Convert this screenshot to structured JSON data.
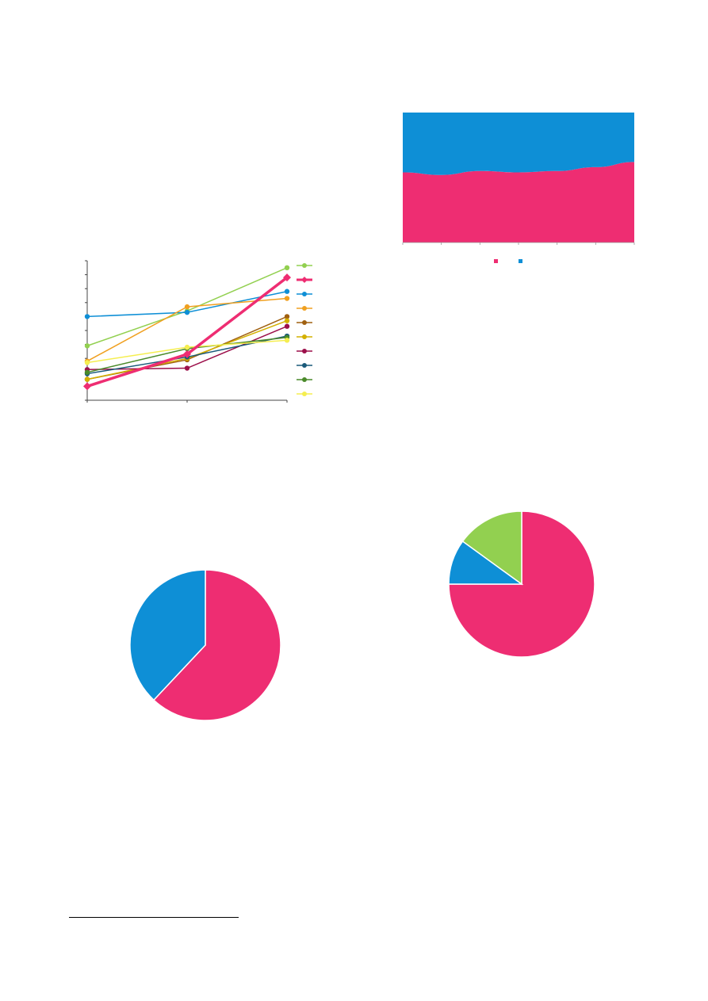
{
  "chart_data": [
    {
      "type": "line",
      "x": [
        0,
        1,
        2
      ],
      "ylim": [
        0,
        100
      ],
      "series": [
        {
          "color": "#92d050",
          "values": [
            39,
            64,
            95
          ],
          "marker": "circle"
        },
        {
          "color": "#ee2d72",
          "values": [
            10,
            33,
            88
          ],
          "marker": "diamond",
          "bold": true
        },
        {
          "color": "#0e8fd6",
          "values": [
            60,
            63,
            78
          ],
          "marker": "circle"
        },
        {
          "color": "#f0a020",
          "values": [
            28,
            67,
            73
          ],
          "marker": "circle"
        },
        {
          "color": "#a06010",
          "values": [
            15,
            29,
            60
          ],
          "marker": "circle"
        },
        {
          "color": "#d4b000",
          "values": [
            15,
            30,
            57
          ],
          "marker": "circle"
        },
        {
          "color": "#9c0f4a",
          "values": [
            22,
            23,
            53
          ],
          "marker": "circle"
        },
        {
          "color": "#1a5a7a",
          "values": [
            19,
            31,
            46
          ],
          "marker": "circle"
        },
        {
          "color": "#4a8a2a",
          "values": [
            20,
            37,
            45
          ],
          "marker": "circle"
        },
        {
          "color": "#f5ee50",
          "values": [
            27,
            38,
            43
          ],
          "marker": "circle"
        }
      ]
    },
    {
      "type": "area",
      "stacked_percent": true,
      "x": [
        0,
        1,
        2,
        3,
        4,
        5,
        6
      ],
      "ylim": [
        0,
        100
      ],
      "series": [
        {
          "color": "#ee2d72",
          "values": [
            54,
            52,
            55,
            54,
            55,
            58,
            62
          ]
        },
        {
          "color": "#0e8fd6",
          "values": [
            46,
            48,
            45,
            46,
            45,
            42,
            38
          ]
        }
      ]
    },
    {
      "type": "pie",
      "values": [
        62,
        38
      ],
      "colors": [
        "#ee2d72",
        "#0e8fd6"
      ]
    },
    {
      "type": "pie",
      "values": [
        75,
        10,
        15
      ],
      "colors": [
        "#ee2d72",
        "#0e8fd6",
        "#92d050"
      ]
    }
  ]
}
